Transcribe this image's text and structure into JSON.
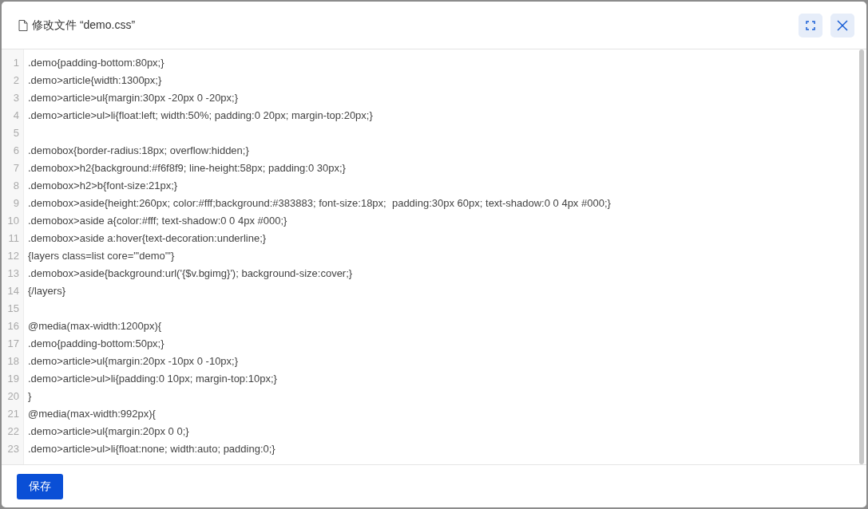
{
  "dialog": {
    "title": "修改文件 “demo.css”"
  },
  "editor": {
    "lines": [
      {
        "number": "1",
        "text": ".demo{padding-bottom:80px;}"
      },
      {
        "number": "2",
        "text": ".demo>article{width:1300px;}"
      },
      {
        "number": "3",
        "text": ".demo>article>ul{margin:30px -20px 0 -20px;}"
      },
      {
        "number": "4",
        "text": ".demo>article>ul>li{float:left; width:50%; padding:0 20px; margin-top:20px;}"
      },
      {
        "number": "5"
      },
      {
        "number": "6",
        "text": ".demobox{border-radius:18px; overflow:hidden;}"
      },
      {
        "number": "7",
        "text": ".demobox>h2{background:#f6f8f9; line-height:58px; padding:0 30px;}"
      },
      {
        "number": "8",
        "text": ".demobox>h2>b{font-size:21px;}"
      },
      {
        "number": "9",
        "text": ".demobox>aside{height:260px; color:#fff;background:#383883; font-size:18px;  padding:30px 60px; text-shadow:0 0 4px #000;}"
      },
      {
        "number": "10",
        "text": ".demobox>aside a{color:#fff; text-shadow:0 0 4px #000;}"
      },
      {
        "number": "11",
        "text": ".demobox>aside a:hover{text-decoration:underline;}"
      },
      {
        "number": "12",
        "text": "{layers class=list core=\"'demo'\"}"
      },
      {
        "number": "13",
        "text": ".demobox>aside{background:url('{$v.bgimg}'); background-size:cover;}"
      },
      {
        "number": "14",
        "text": "{/layers}"
      },
      {
        "number": "15"
      },
      {
        "number": "16",
        "text": "@media(max-width:1200px){"
      },
      {
        "number": "17",
        "text": ".demo{padding-bottom:50px;}"
      },
      {
        "number": "18",
        "text": ".demo>article>ul{margin:20px -10px 0 -10px;}"
      },
      {
        "number": "19",
        "text": ".demo>article>ul>li{padding:0 10px; margin-top:10px;}"
      },
      {
        "number": "20",
        "text": "}"
      },
      {
        "number": "21",
        "text": "@media(max-width:992px){"
      },
      {
        "number": "22",
        "text": ".demo>article>ul{margin:20px 0 0;}"
      },
      {
        "number": "23",
        "text": ".demo>article>ul>li{float:none; width:auto; padding:0;}"
      }
    ]
  },
  "footer": {
    "save_button": "保存"
  }
}
